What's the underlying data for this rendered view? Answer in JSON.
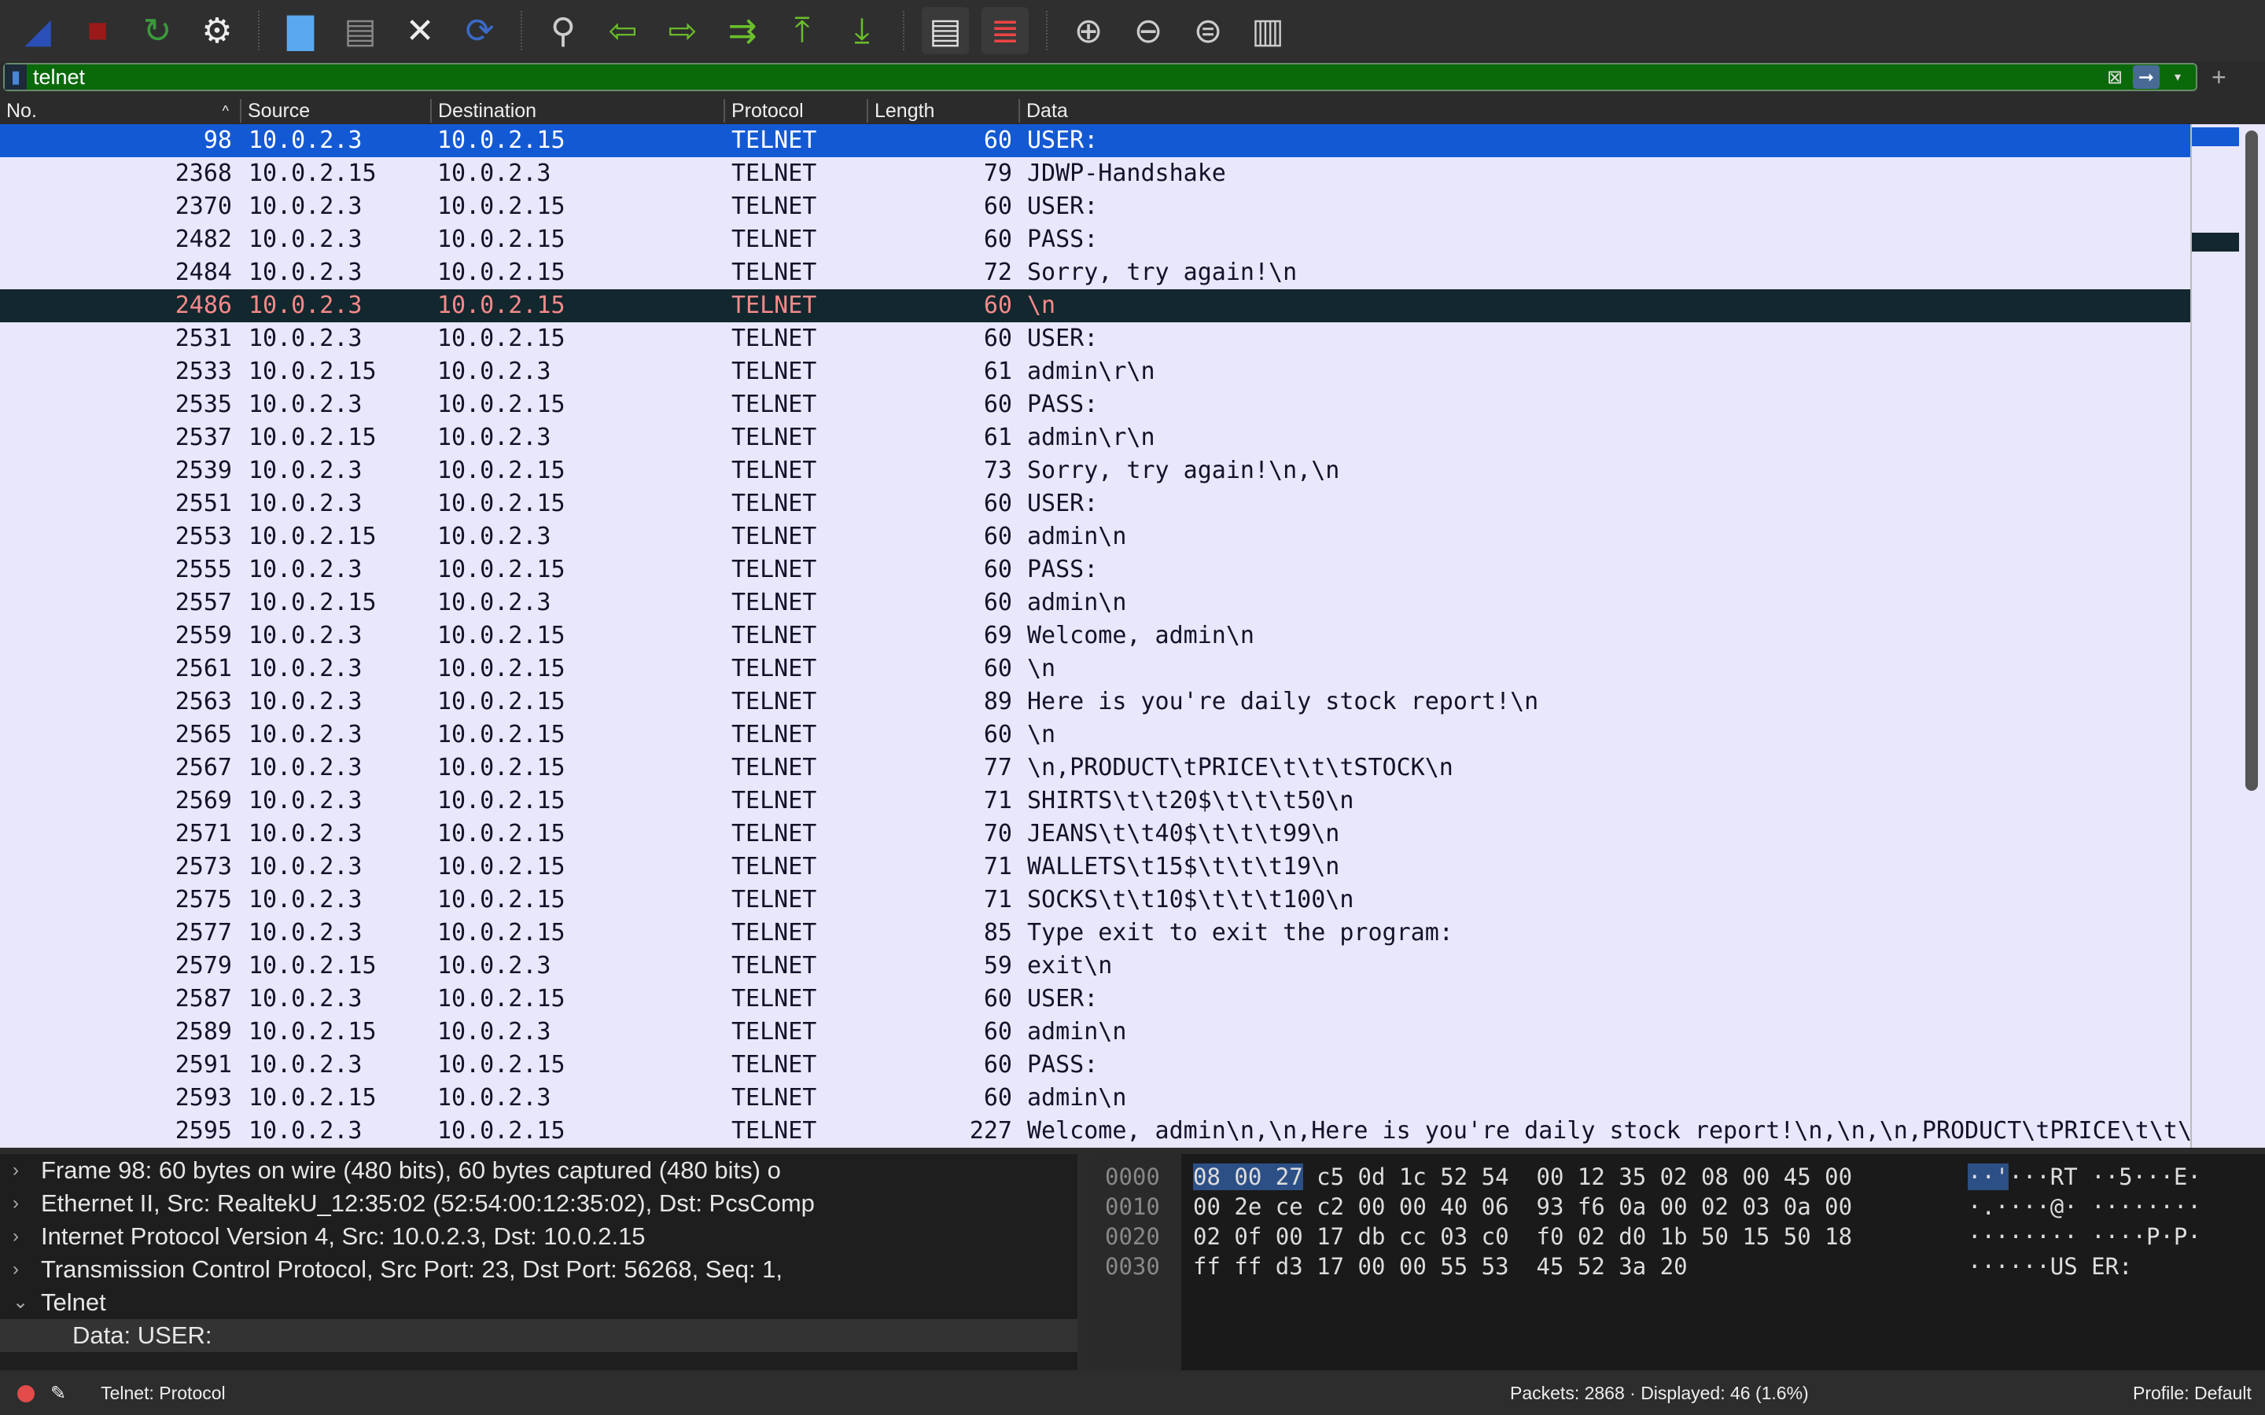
{
  "toolbar": {
    "icons": [
      "shark-fin-start-icon",
      "stop-capture-icon",
      "restart-capture-icon",
      "capture-options-icon",
      "open-file-icon",
      "save-file-icon",
      "close-file-icon",
      "reload-file-icon",
      "find-packet-icon",
      "go-back-icon",
      "go-forward-icon",
      "go-to-packet-icon",
      "first-packet-icon",
      "last-packet-icon",
      "autoscroll-icon",
      "colorize-icon",
      "zoom-in-icon",
      "zoom-out-icon",
      "normal-size-icon",
      "resize-columns-icon"
    ]
  },
  "filter": {
    "value": "telnet"
  },
  "columns": [
    "No.",
    "Source",
    "Destination",
    "Protocol",
    "Length",
    "Data"
  ],
  "packets": [
    [
      "98",
      "10.0.2.3",
      "10.0.2.15",
      "TELNET",
      "60",
      "USER:"
    ],
    [
      "2368",
      "10.0.2.15",
      "10.0.2.3",
      "TELNET",
      "79",
      "JDWP-Handshake"
    ],
    [
      "2370",
      "10.0.2.3",
      "10.0.2.15",
      "TELNET",
      "60",
      "USER:"
    ],
    [
      "2482",
      "10.0.2.3",
      "10.0.2.15",
      "TELNET",
      "60",
      "PASS:"
    ],
    [
      "2484",
      "10.0.2.3",
      "10.0.2.15",
      "TELNET",
      "72",
      "Sorry, try again!\\n"
    ],
    [
      "2486",
      "10.0.2.3",
      "10.0.2.15",
      "TELNET",
      "60",
      "\\n"
    ],
    [
      "2531",
      "10.0.2.3",
      "10.0.2.15",
      "TELNET",
      "60",
      "USER:"
    ],
    [
      "2533",
      "10.0.2.15",
      "10.0.2.3",
      "TELNET",
      "61",
      "admin\\r\\n"
    ],
    [
      "2535",
      "10.0.2.3",
      "10.0.2.15",
      "TELNET",
      "60",
      "PASS:"
    ],
    [
      "2537",
      "10.0.2.15",
      "10.0.2.3",
      "TELNET",
      "61",
      "admin\\r\\n"
    ],
    [
      "2539",
      "10.0.2.3",
      "10.0.2.15",
      "TELNET",
      "73",
      "Sorry, try again!\\n,\\n"
    ],
    [
      "2551",
      "10.0.2.3",
      "10.0.2.15",
      "TELNET",
      "60",
      "USER:"
    ],
    [
      "2553",
      "10.0.2.15",
      "10.0.2.3",
      "TELNET",
      "60",
      "admin\\n"
    ],
    [
      "2555",
      "10.0.2.3",
      "10.0.2.15",
      "TELNET",
      "60",
      "PASS:"
    ],
    [
      "2557",
      "10.0.2.15",
      "10.0.2.3",
      "TELNET",
      "60",
      "admin\\n"
    ],
    [
      "2559",
      "10.0.2.3",
      "10.0.2.15",
      "TELNET",
      "69",
      "Welcome, admin\\n"
    ],
    [
      "2561",
      "10.0.2.3",
      "10.0.2.15",
      "TELNET",
      "60",
      "\\n"
    ],
    [
      "2563",
      "10.0.2.3",
      "10.0.2.15",
      "TELNET",
      "89",
      "Here is you're daily stock report!\\n"
    ],
    [
      "2565",
      "10.0.2.3",
      "10.0.2.15",
      "TELNET",
      "60",
      "\\n"
    ],
    [
      "2567",
      "10.0.2.3",
      "10.0.2.15",
      "TELNET",
      "77",
      "\\n,PRODUCT\\tPRICE\\t\\t\\tSTOCK\\n"
    ],
    [
      "2569",
      "10.0.2.3",
      "10.0.2.15",
      "TELNET",
      "71",
      "SHIRTS\\t\\t20$\\t\\t\\t50\\n"
    ],
    [
      "2571",
      "10.0.2.3",
      "10.0.2.15",
      "TELNET",
      "70",
      "JEANS\\t\\t40$\\t\\t\\t99\\n"
    ],
    [
      "2573",
      "10.0.2.3",
      "10.0.2.15",
      "TELNET",
      "71",
      "WALLETS\\t15$\\t\\t\\t19\\n"
    ],
    [
      "2575",
      "10.0.2.3",
      "10.0.2.15",
      "TELNET",
      "71",
      "SOCKS\\t\\t10$\\t\\t\\t100\\n"
    ],
    [
      "2577",
      "10.0.2.3",
      "10.0.2.15",
      "TELNET",
      "85",
      "Type exit to exit the program:"
    ],
    [
      "2579",
      "10.0.2.15",
      "10.0.2.3",
      "TELNET",
      "59",
      "exit\\n"
    ],
    [
      "2587",
      "10.0.2.3",
      "10.0.2.15",
      "TELNET",
      "60",
      "USER:"
    ],
    [
      "2589",
      "10.0.2.15",
      "10.0.2.3",
      "TELNET",
      "60",
      "admin\\n"
    ],
    [
      "2591",
      "10.0.2.3",
      "10.0.2.15",
      "TELNET",
      "60",
      "PASS:"
    ],
    [
      "2593",
      "10.0.2.15",
      "10.0.2.3",
      "TELNET",
      "60",
      "admin\\n"
    ],
    [
      "2595",
      "10.0.2.3",
      "10.0.2.15",
      "TELNET",
      "227",
      "Welcome, admin\\n,\\n,Here is you're daily stock report!\\n,\\n,\\n,PRODUCT\\tPRICE\\t\\t\\"
    ]
  ],
  "selected_index": 0,
  "details": [
    {
      "text": "Frame 98: 60 bytes on wire (480 bits), 60 bytes captured (480 bits) o",
      "expanded": false
    },
    {
      "text": "Ethernet II, Src: RealtekU_12:35:02 (52:54:00:12:35:02), Dst: PcsComp",
      "expanded": false
    },
    {
      "text": "Internet Protocol Version 4, Src: 10.0.2.3, Dst: 10.0.2.15",
      "expanded": false
    },
    {
      "text": "Transmission Control Protocol, Src Port: 23, Dst Port: 56268, Seq: 1,",
      "expanded": false
    },
    {
      "text": "Telnet",
      "expanded": true
    },
    {
      "text": "Data: USER:",
      "sub": true
    }
  ],
  "hex": {
    "offsets": [
      "0000",
      "0010",
      "0020",
      "0030"
    ],
    "bytes_sel": [
      "08 00 27",
      "",
      "",
      ""
    ],
    "bytes": [
      " c5 0d 1c 52 54  00 12 35 02 08 00 45 00",
      "00 2e ce c2 00 00 40 06  93 f6 0a 00 02 03 0a 00",
      "02 0f 00 17 db cc 03 c0  f0 02 d0 1b 50 15 50 18",
      "ff ff d3 17 00 00 55 53  45 52 3a 20"
    ],
    "ascii_sel": [
      "··'",
      "",
      "",
      ""
    ],
    "ascii": [
      "···RT ··5···E·",
      "·.····@· ········",
      "········ ····P·P·",
      "······US ER:"
    ]
  },
  "status": {
    "field": "Telnet: Protocol",
    "packets": "Packets: 2868 · Displayed: 46 (1.6%)",
    "profile": "Profile: Default"
  },
  "colors": {
    "row_bg": "#e8e7fc",
    "selected": "#1459d4",
    "bad_row_bg": "#12272e",
    "bad_row_fg": "#f78a8a",
    "filter_ok": "#0a6a0a"
  }
}
